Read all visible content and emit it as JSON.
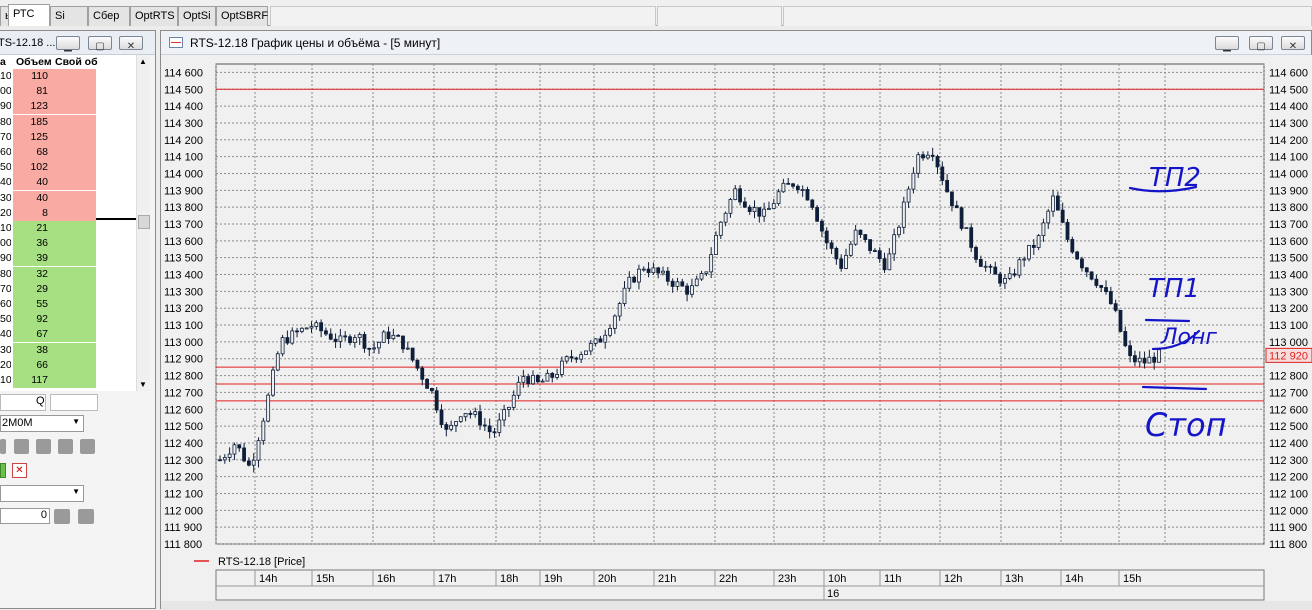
{
  "tabs": [
    "ы",
    "РТС",
    "Si",
    "Сбер",
    "OptRTS",
    "OptSi",
    "OptSBRF"
  ],
  "active_tab": 1,
  "left_window": {
    "title": "TS-12.18 ...",
    "headers": [
      "а",
      "Объем",
      "Свой об"
    ],
    "asks": [
      {
        "price": "10",
        "volume": "110"
      },
      {
        "price": "00",
        "volume": "81"
      },
      {
        "price": "90",
        "volume": "123"
      },
      {
        "price": "80",
        "volume": "185"
      },
      {
        "price": "70",
        "volume": "125"
      },
      {
        "price": "60",
        "volume": "68"
      },
      {
        "price": "50",
        "volume": "102"
      },
      {
        "price": "40",
        "volume": "40"
      },
      {
        "price": "30",
        "volume": "40"
      },
      {
        "price": "20",
        "volume": "8"
      }
    ],
    "bids": [
      {
        "price": "10",
        "volume": "21"
      },
      {
        "price": "00",
        "volume": "36"
      },
      {
        "price": "90",
        "volume": "39"
      },
      {
        "price": "80",
        "volume": "32"
      },
      {
        "price": "70",
        "volume": "29"
      },
      {
        "price": "60",
        "volume": "55"
      },
      {
        "price": "50",
        "volume": "92"
      },
      {
        "price": "40",
        "volume": "67"
      },
      {
        "price": "30",
        "volume": "38"
      },
      {
        "price": "20",
        "volume": "66"
      },
      {
        "price": "10",
        "volume": "117"
      }
    ],
    "q_label": "Q",
    "account": "2M0M",
    "qty_value": "0"
  },
  "chart_window": {
    "title": "RTS-12.18 График цены и объёма - [5 минут]",
    "legend": "RTS-12.18 [Price]",
    "last_price_label": "112 920",
    "date_label": "16",
    "colors": {
      "ask_bg": "#f8aaa3",
      "bid_bg": "#a6e082",
      "level_line": "#e02020",
      "candle": "#0f1f3a",
      "annotation": "#1414c8"
    },
    "annotations": [
      "ТП2",
      "ТП1",
      "Лонг",
      "Стоп"
    ]
  },
  "chart_data": {
    "type": "candlestick",
    "symbol": "RTS-12.18",
    "interval": "5 минут",
    "ylim": [
      111800,
      114650
    ],
    "y_ticks": [
      "114 600",
      "114 500",
      "114 400",
      "114 300",
      "114 200",
      "114 100",
      "114 000",
      "113 900",
      "113 800",
      "113 700",
      "113 600",
      "113 500",
      "113 400",
      "113 300",
      "113 200",
      "113 100",
      "113 000",
      "112 900",
      "112 800",
      "112 700",
      "112 600",
      "112 500",
      "112 400",
      "112 300",
      "112 200",
      "112 100",
      "112 000",
      "111 900",
      "111 800"
    ],
    "x_ticks": [
      "14h",
      "15h",
      "16h",
      "17h",
      "18h",
      "19h",
      "20h",
      "21h",
      "22h",
      "23h",
      "10h",
      "11h",
      "12h",
      "13h",
      "14h",
      "15h"
    ],
    "horizontal_levels": [
      114500,
      112850,
      112750,
      112650
    ],
    "last_price": 112920,
    "grid": true,
    "close_path": [
      [
        0,
        112300
      ],
      [
        2,
        112400
      ],
      [
        4,
        112250
      ],
      [
        6,
        112600
      ],
      [
        8,
        113000
      ],
      [
        10,
        113050
      ],
      [
        12,
        113100
      ],
      [
        14,
        113050
      ],
      [
        16,
        113000
      ],
      [
        18,
        113050
      ],
      [
        20,
        112950
      ],
      [
        22,
        113050
      ],
      [
        24,
        113000
      ],
      [
        26,
        112850
      ],
      [
        28,
        112700
      ],
      [
        30,
        112450
      ],
      [
        32,
        112600
      ],
      [
        34,
        112550
      ],
      [
        36,
        112450
      ],
      [
        38,
        112600
      ],
      [
        40,
        112800
      ],
      [
        42,
        112750
      ],
      [
        44,
        112800
      ],
      [
        46,
        112900
      ],
      [
        48,
        112950
      ],
      [
        50,
        113000
      ],
      [
        52,
        113150
      ],
      [
        54,
        113350
      ],
      [
        56,
        113450
      ],
      [
        58,
        113400
      ],
      [
        60,
        113350
      ],
      [
        62,
        113300
      ],
      [
        64,
        113400
      ],
      [
        66,
        113700
      ],
      [
        68,
        113900
      ],
      [
        70,
        113800
      ],
      [
        72,
        113750
      ],
      [
        74,
        113900
      ],
      [
        76,
        113950
      ],
      [
        78,
        113850
      ],
      [
        80,
        113600
      ],
      [
        82,
        113450
      ],
      [
        84,
        113650
      ],
      [
        86,
        113550
      ],
      [
        88,
        113450
      ],
      [
        90,
        113750
      ],
      [
        92,
        114100
      ],
      [
        94,
        114150
      ],
      [
        96,
        113900
      ],
      [
        98,
        113700
      ],
      [
        100,
        113500
      ],
      [
        102,
        113400
      ],
      [
        104,
        113350
      ],
      [
        106,
        113500
      ],
      [
        108,
        113600
      ],
      [
        110,
        113850
      ],
      [
        112,
        113600
      ],
      [
        114,
        113450
      ],
      [
        116,
        113350
      ],
      [
        118,
        113200
      ],
      [
        120,
        112900
      ],
      [
        122,
        112880
      ],
      [
        124,
        112920
      ]
    ]
  }
}
